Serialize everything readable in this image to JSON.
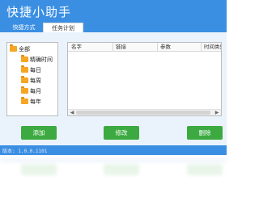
{
  "window": {
    "title": "快捷小助手"
  },
  "tabs": [
    {
      "label": "快捷方式",
      "selected": false
    },
    {
      "label": "任务计划",
      "selected": true
    }
  ],
  "tree": {
    "root": {
      "label": "全部",
      "icon": "folder-icon"
    },
    "children": [
      {
        "label": "精确时间",
        "icon": "folder-icon"
      },
      {
        "label": "每日",
        "icon": "folder-icon"
      },
      {
        "label": "每周",
        "icon": "folder-icon"
      },
      {
        "label": "每月",
        "icon": "folder-icon"
      },
      {
        "label": "每年",
        "icon": "folder-icon"
      }
    ]
  },
  "grid": {
    "columns": [
      "名字",
      "链接",
      "参数",
      "时间类型"
    ],
    "rows": []
  },
  "buttons": {
    "add": "添加",
    "edit": "修改",
    "delete": "删除"
  },
  "status": {
    "version": "版本: 1.0.0.1101"
  },
  "colors": {
    "title_bar": "#3b8fe3",
    "button": "#3caa41",
    "folder": "#f5a623",
    "client": "#eaf3fc"
  }
}
